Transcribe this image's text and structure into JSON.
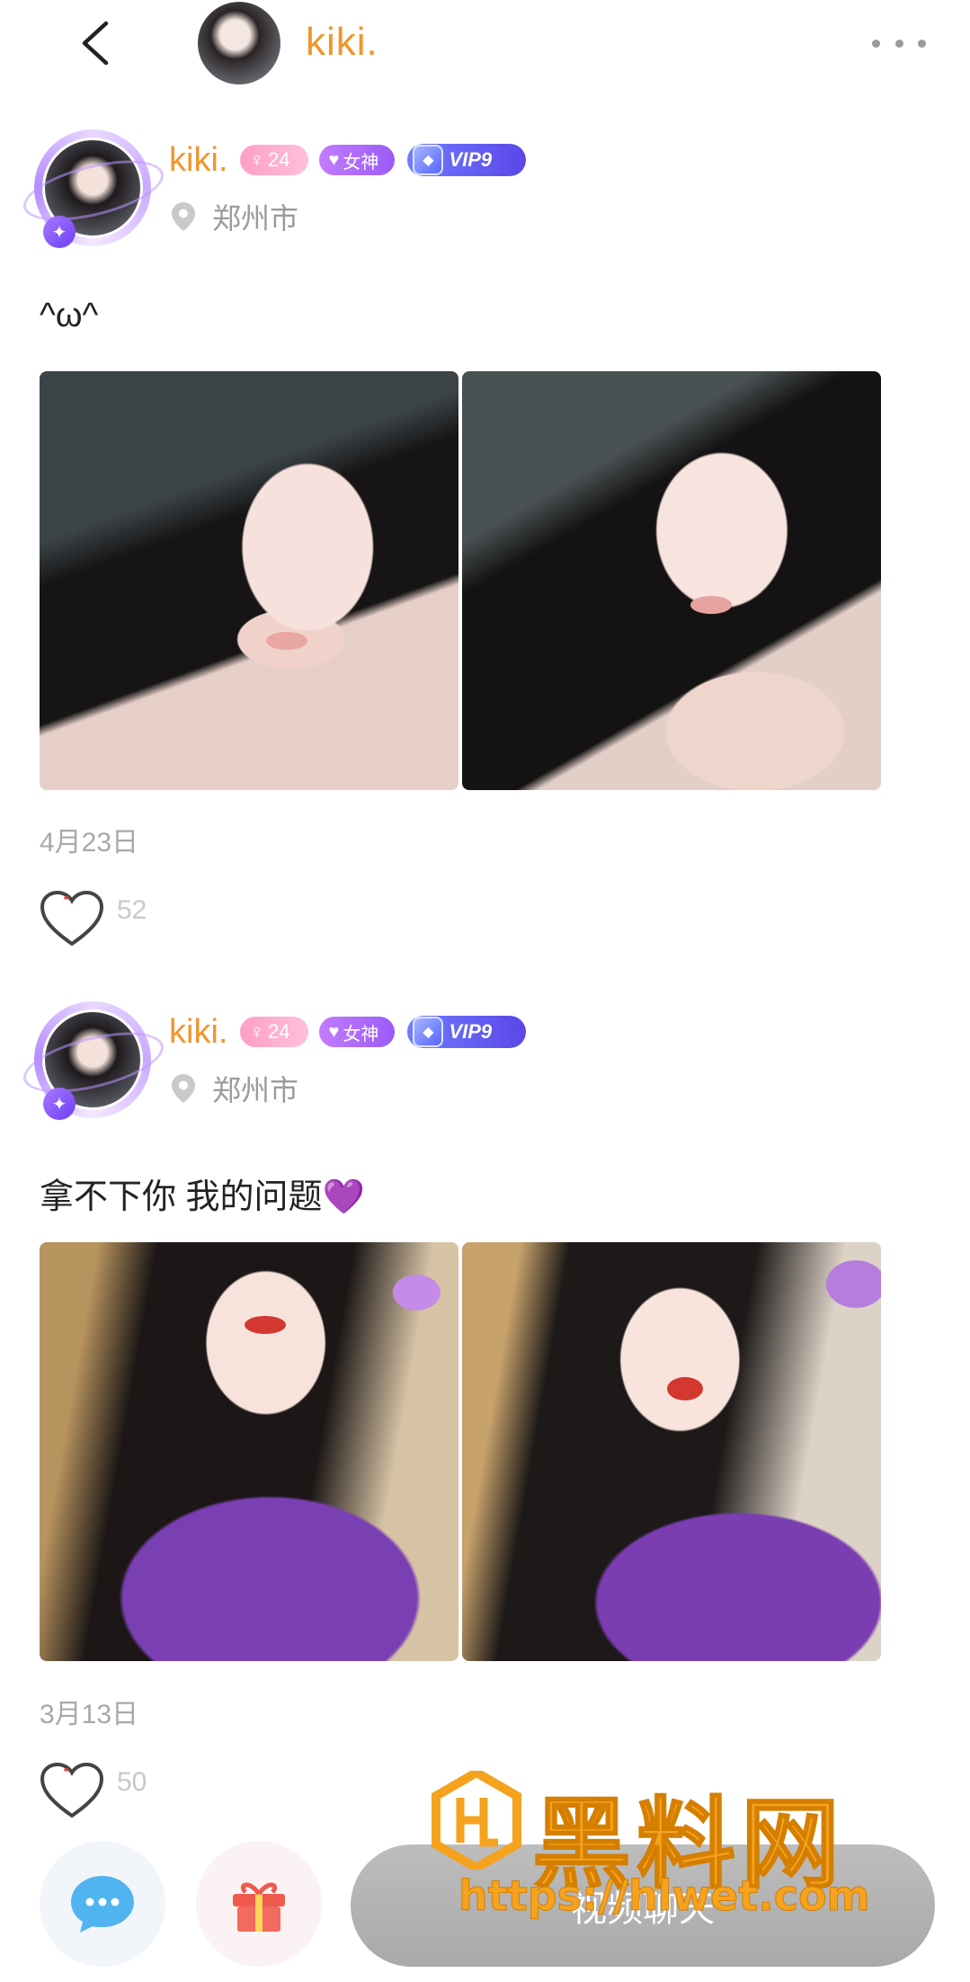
{
  "header": {
    "title": "kiki.",
    "back_icon": "chevron-left-icon",
    "more_icon": "more-horizontal-icon"
  },
  "posts": [
    {
      "name": "kiki.",
      "age": "24",
      "goddess_label": "女神",
      "vip_label": "VIP9",
      "location": "郑州市",
      "text": "^ω^",
      "date": "4月23日",
      "likes": "52"
    },
    {
      "name": "kiki.",
      "age": "24",
      "goddess_label": "女神",
      "vip_label": "VIP9",
      "location": "郑州市",
      "text": "拿不下你 我的问题💜",
      "date": "3月13日",
      "likes": "50"
    }
  ],
  "bottom_bar": {
    "chat_icon": "chat-bubble-icon",
    "gift_icon": "gift-icon",
    "video_label": "视频聊天"
  },
  "watermark": {
    "title": "黑料网",
    "url": "https://hlwet.com"
  },
  "colors": {
    "name_accent": "#f0962a",
    "vip_gradient_start": "#6f7dff",
    "goddess_badge": "#b36cfb",
    "age_badge": "#ff9fc6",
    "watermark": "#f5a21f"
  }
}
